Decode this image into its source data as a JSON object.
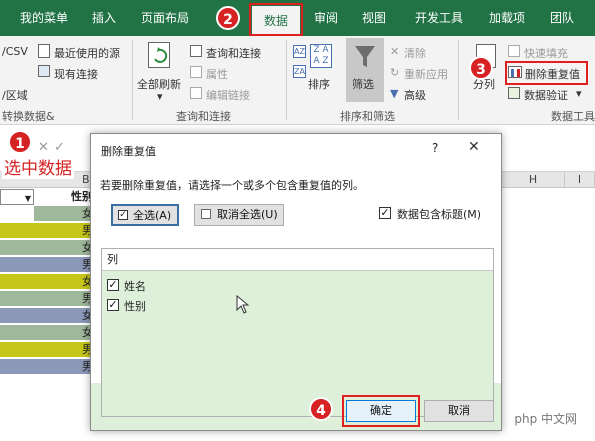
{
  "tabs": [
    {
      "label": "我的菜单",
      "active": false
    },
    {
      "label": "插入",
      "active": false
    },
    {
      "label": "页面布局",
      "active": false
    },
    {
      "label": "数据",
      "active": true
    },
    {
      "label": "审阅",
      "active": false
    },
    {
      "label": "视图",
      "active": false
    },
    {
      "label": "开发工具",
      "active": false
    },
    {
      "label": "加载项",
      "active": false
    },
    {
      "label": "团队",
      "active": false
    }
  ],
  "ribbon": {
    "get_data": {
      "csv": "/CSV",
      "recent_sources": "最近使用的源",
      "existing": "现有连接",
      "region": "/区域",
      "group": "转换数据&"
    },
    "queries": {
      "refresh_all": "全部刷新",
      "queries_conn": "查询和连接",
      "properties": "属性",
      "edit_links": "编辑链接",
      "group": "查询和连接"
    },
    "sort_filter": {
      "sort": "排序",
      "filter": "筛选",
      "clear": "清除",
      "reapply": "重新应用",
      "advanced": "高级",
      "group": "排序和筛选"
    },
    "data_tools": {
      "split": "分列",
      "flash_fill": "快速填充",
      "remove_dup": "删除重复值",
      "validation": "数据验证",
      "group": "数据工具"
    }
  },
  "sheet": {
    "columns": [
      "B",
      "H",
      "I"
    ],
    "header_cell": "性别",
    "cells": [
      "女",
      "男",
      "女",
      "男",
      "女",
      "男",
      "女",
      "女",
      "男",
      "男"
    ],
    "cell_colors": [
      "#9fb79a",
      "#c6c61a",
      "#9fb79a",
      "#8b98b8",
      "#c6c61a",
      "#9fb79a",
      "#8b98b8",
      "#9fb79a",
      "#c6c61a",
      "#8b98b8"
    ]
  },
  "dialog": {
    "title": "删除重复值",
    "help": "?",
    "close": "✕",
    "instruction": "若要删除重复值，请选择一个或多个包含重复值的列。",
    "select_all": "全选(A)",
    "unselect_all": "取消全选(U)",
    "has_header": "数据包含标题(M)",
    "header_checked": true,
    "list_header": "列",
    "columns": [
      {
        "label": "姓名",
        "checked": true
      },
      {
        "label": "性别",
        "checked": true
      }
    ],
    "ok": "确定",
    "cancel": "取消"
  },
  "annotations": {
    "step1": "1",
    "step1_text": "选中数据",
    "step2": "2",
    "step3": "3",
    "step4": "4"
  },
  "watermark": "php 中文网",
  "colors": {
    "excel_green": "#217346",
    "annotation_red": "#d62222",
    "dialog_bg": "#dff0da"
  }
}
